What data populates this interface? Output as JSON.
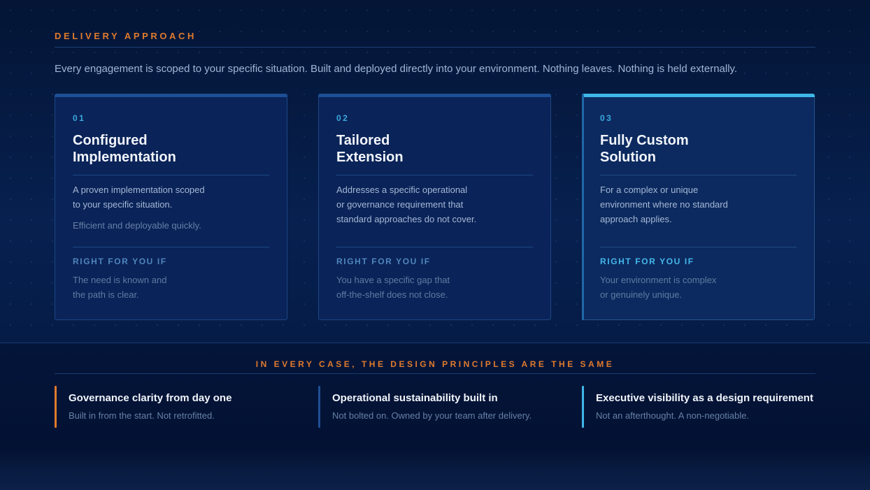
{
  "header": {
    "eyebrow": "DELIVERY APPROACH",
    "intro": "Every engagement is scoped to your specific situation. Built and deployed directly into your environment. Nothing leaves. Nothing is held externally."
  },
  "cards": [
    {
      "number": "01",
      "title_line1": "Configured",
      "title_line2": "Implementation",
      "desc_line1": "A proven implementation scoped",
      "desc_line2": "to your specific situation.",
      "desc_line3": "",
      "note": "Efficient and deployable quickly.",
      "right_label": "RIGHT FOR YOU IF",
      "right_line1": "The need is known and",
      "right_line2": "the path is clear.",
      "featured": false
    },
    {
      "number": "02",
      "title_line1": "Tailored",
      "title_line2": "Extension",
      "desc_line1": "Addresses a specific operational",
      "desc_line2": "or governance requirement that",
      "desc_line3": "standard approaches do not cover.",
      "note": "",
      "right_label": "RIGHT FOR YOU IF",
      "right_line1": "You have a specific gap that",
      "right_line2": "off-the-shelf does not close.",
      "featured": false
    },
    {
      "number": "03",
      "title_line1": "Fully Custom",
      "title_line2": "Solution",
      "desc_line1": "For a complex or unique",
      "desc_line2": "environment where no standard",
      "desc_line3": "approach applies.",
      "note": "",
      "right_label": "RIGHT FOR YOU IF",
      "right_line1": "Your environment is complex",
      "right_line2": "or genuinely unique.",
      "featured": true
    }
  ],
  "principles": {
    "heading": "IN EVERY CASE, THE DESIGN PRINCIPLES ARE THE SAME",
    "items": [
      {
        "title": "Governance clarity from day one",
        "subtitle": "Built in from the start. Not retrofitted.",
        "accent": "#e07a2c"
      },
      {
        "title": "Operational sustainability built in",
        "subtitle": "Not bolted on. Owned by your team after delivery.",
        "accent": "#1f4f95"
      },
      {
        "title": "Executive visibility as a design requirement",
        "subtitle": "Not an afterthought. A non-negotiable.",
        "accent": "#3fb6e8"
      }
    ]
  },
  "colors": {
    "background": "#071a45",
    "accent_orange": "#e07a2c",
    "accent_cyan": "#3fb6e8",
    "card_bg": "#0a2358"
  }
}
